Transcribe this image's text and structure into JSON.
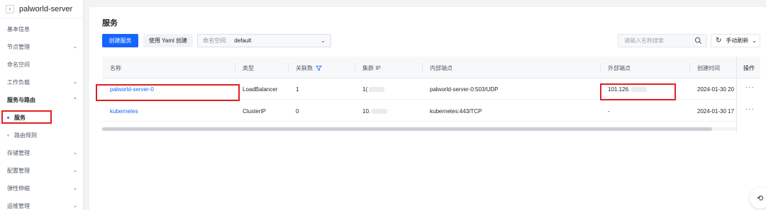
{
  "sidebar": {
    "back_icon": "chevron-left-icon",
    "title": "palworld-server",
    "items": [
      {
        "label": "基本信息",
        "has_chevron": false
      },
      {
        "label": "节点管理",
        "has_chevron": true
      },
      {
        "label": "命名空间",
        "has_chevron": false
      },
      {
        "label": "工作负载",
        "has_chevron": true
      },
      {
        "label": "服务与路由",
        "has_chevron": true,
        "expanded": true
      },
      {
        "label": "服务",
        "sub": true,
        "active": true
      },
      {
        "label": "路由规则",
        "sub": true
      },
      {
        "label": "存储管理",
        "has_chevron": true
      },
      {
        "label": "配置管理",
        "has_chevron": true
      },
      {
        "label": "弹性伸缩",
        "has_chevron": true
      },
      {
        "label": "运维管理",
        "has_chevron": true
      }
    ],
    "chev_down": "⌄",
    "chev_up": "⌃"
  },
  "page": {
    "title": "服务",
    "create_button": "创建服务",
    "yaml_button": "使用 Yaml 创建",
    "namespace_label": "命名空间:",
    "namespace_value": "default",
    "search_placeholder": "请输入名称搜索",
    "refresh_label": "手动刷新"
  },
  "table": {
    "columns": [
      "名称",
      "类型",
      "关联数",
      "集群 IP",
      "内部端点",
      "外部端点",
      "创建时间",
      "操作"
    ],
    "rows": [
      {
        "name": "palworld-server-0",
        "type": "LoadBalancer",
        "count": "1",
        "cluster_ip": "1(",
        "internal": "palworld-server-0:503/UDP",
        "external": "101.126.",
        "created": "2024-01-30 20"
      },
      {
        "name": "kubernetes",
        "type": "ClusterIP",
        "count": "0",
        "cluster_ip": "10.",
        "internal": "kubernetes:443/TCP",
        "external": "-",
        "created": "2024-01-30 17"
      }
    ],
    "ops_glyph": "···"
  },
  "colors": {
    "primary": "#1664ff",
    "highlight": "#e02020"
  }
}
